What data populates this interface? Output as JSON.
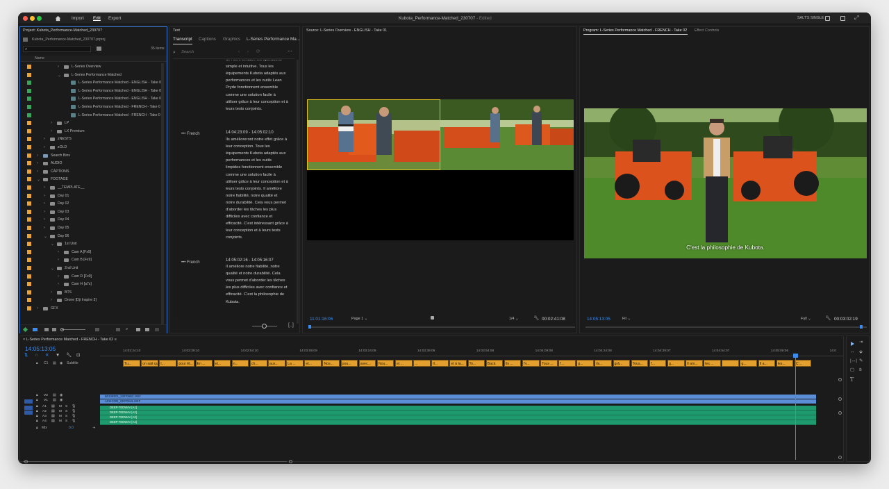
{
  "window": {
    "title": "Kubota_Performance-Matched_230707",
    "edited": "- Edited",
    "menu": [
      "Import",
      "Edit",
      "Export"
    ],
    "workspace": "SALT'S SINGLE"
  },
  "project": {
    "title": "Project: Kubota_Performance-Matched_230707",
    "file": "Kubota_Performance-Matched_230707.prproj",
    "items_count": "35 items",
    "name_header": "Name",
    "rows": [
      {
        "label": "L-Series Overview",
        "indent": 2,
        "type": "folder",
        "color": "#e8a33a",
        "chev": "›"
      },
      {
        "label": "L-Series Performance Matched",
        "indent": 2,
        "type": "folder",
        "color": "#e8a33a",
        "chev": "⌄"
      },
      {
        "label": "L-Series Performance Matched - ENGLISH - Take 0",
        "indent": 3,
        "type": "clip",
        "color": "#3aa55a",
        "chev": ""
      },
      {
        "label": "L-Series Performance Matched - ENGLISH - Take 0",
        "indent": 3,
        "type": "clip",
        "color": "#3aa55a",
        "chev": ""
      },
      {
        "label": "L-Series Performance Matched - ENGLISH - Take 0",
        "indent": 3,
        "type": "clip",
        "color": "#3aa55a",
        "chev": ""
      },
      {
        "label": "L-Series Performance Matched - FRENCH - Take 0",
        "indent": 3,
        "type": "clip",
        "color": "#3aa55a",
        "chev": ""
      },
      {
        "label": "L-Series Performance Matched - FRENCH - Take 0",
        "indent": 3,
        "type": "clip",
        "color": "#3aa55a",
        "chev": ""
      },
      {
        "label": "LP",
        "indent": 1,
        "type": "folder",
        "color": "#e8a33a",
        "chev": "›"
      },
      {
        "label": "LX Premium",
        "indent": 1,
        "type": "folder",
        "color": "#e8a33a",
        "chev": "›"
      },
      {
        "label": "zNESTS",
        "indent": 0,
        "type": "folder",
        "color": "#e8a33a",
        "chev": "›"
      },
      {
        "label": "zOLD",
        "indent": 0,
        "type": "folder",
        "color": "#e8a33a",
        "chev": "›"
      },
      {
        "label": "Search Bins",
        "indent": -1,
        "type": "search",
        "color": "#e8a33a",
        "chev": "›"
      },
      {
        "label": "AUDIO",
        "indent": -1,
        "type": "folder",
        "color": "#e8a33a",
        "chev": "›"
      },
      {
        "label": "CAPTIONS",
        "indent": -1,
        "type": "folder",
        "color": "#e8a33a",
        "chev": "›"
      },
      {
        "label": "FOOTAGE",
        "indent": -1,
        "type": "folder",
        "color": "#e8a33a",
        "chev": "⌄"
      },
      {
        "label": "__TEMPLATE__",
        "indent": 0,
        "type": "folder",
        "color": "#e8a33a",
        "chev": "›"
      },
      {
        "label": "Day 01",
        "indent": 0,
        "type": "folder",
        "color": "#e8a33a",
        "chev": "›"
      },
      {
        "label": "Day 02",
        "indent": 0,
        "type": "folder",
        "color": "#e8a33a",
        "chev": "›"
      },
      {
        "label": "Day 03",
        "indent": 0,
        "type": "folder",
        "color": "#e8a33a",
        "chev": "›"
      },
      {
        "label": "Day 04",
        "indent": 0,
        "type": "folder",
        "color": "#e8a33a",
        "chev": "›"
      },
      {
        "label": "Day 05",
        "indent": 0,
        "type": "folder",
        "color": "#e8a33a",
        "chev": "›"
      },
      {
        "label": "Day 06",
        "indent": 0,
        "type": "folder",
        "color": "#e8a33a",
        "chev": "⌄"
      },
      {
        "label": "1st Unit",
        "indent": 1,
        "type": "folder",
        "color": "#e8a33a",
        "chev": "⌄"
      },
      {
        "label": "Cam A [Fx9]",
        "indent": 2,
        "type": "folder",
        "color": "#e8a33a",
        "chev": "›"
      },
      {
        "label": "Cam B [Fx9]",
        "indent": 2,
        "type": "folder",
        "color": "#e8a33a",
        "chev": "›"
      },
      {
        "label": "2nd Unit",
        "indent": 1,
        "type": "folder",
        "color": "#e8a33a",
        "chev": "⌄"
      },
      {
        "label": "Cam D [Fx9]",
        "indent": 2,
        "type": "folder",
        "color": "#e8a33a",
        "chev": "›"
      },
      {
        "label": "Cam H [a7s]",
        "indent": 2,
        "type": "folder",
        "color": "#e8a33a",
        "chev": "›"
      },
      {
        "label": "BTS",
        "indent": 1,
        "type": "folder",
        "color": "#e8a33a",
        "chev": "›"
      },
      {
        "label": "Drone [Dji Inspire 3]",
        "indent": 1,
        "type": "folder",
        "color": "#e8a33a",
        "chev": "›"
      },
      {
        "label": "GFX",
        "indent": -1,
        "type": "folder",
        "color": "#e8a33a",
        "chev": "›"
      }
    ]
  },
  "text_panel": {
    "title": "Text",
    "tabs": [
      "Transcript",
      "Captions",
      "Graphics",
      "L-Series Performance Ma..."
    ],
    "search_placeholder": "Search",
    "block0_lines": [
      "de l'offre tentaire les opérations",
      "simple et intuitive. Tous les",
      "équipements Kubota adaptés aux",
      "performances et les outils Lean",
      "Pryde fonctionnent ensemble",
      "comme une solution facile à",
      "utiliser grâce à leur conception et à",
      "leurs tests conjoints."
    ],
    "block1": {
      "speaker": "French",
      "time": "14:04:23:09 - 14:05:02:10",
      "lines": [
        "Ils amélioreront notre effet grâce à",
        "leur conception. Tous les",
        "équipements Kubota adaptés aux",
        "performances et les outils",
        "limpides fonctionnent ensemble",
        "comme une solution facile à",
        "utiliser grâce à leur conception et à",
        "leurs tests conjoints. Il améliore",
        "notre fiabilité, notre qualité et",
        "notre durabilité. Cela vous permet",
        "d'aborder les tâches les plus",
        "difficiles avec confiance et",
        "efficacité. C'est intéressant grâce à",
        "leur conception et à leurs tests",
        "conjoints."
      ]
    },
    "block2": {
      "speaker": "French",
      "time": "14:05:02:16 - 14:05:16:07",
      "lines": [
        "Il améliore notre fiabilité, notre",
        "qualité et notre durabilité. Cela",
        "vous permet d'aborder les tâches",
        "les plus difficiles avec confiance et",
        "efficacité. C'est la philosophie de",
        "Kubota."
      ]
    }
  },
  "source_monitor": {
    "title": "Source: L-Series Overview - ENGLISH - Take 01",
    "timecode": "11:01:16:06",
    "page": "Page 1",
    "fraction": "1/4",
    "duration": "00:02:41:08"
  },
  "program_monitor": {
    "title": "Program: L-Series Performance Matched - FRENCH - Take 02",
    "effect_controls": "Effect Controls",
    "caption": "C'est la philosophie de Kubota.",
    "timecode": "14:05:13:05",
    "fit": "Fit",
    "quality": "Full",
    "duration": "00:03:02:19"
  },
  "timeline": {
    "title": "L-Series Performance Matched - FRENCH - Take 02",
    "timecode": "14:05:13:05",
    "ruler": [
      "14:02:24:10",
      "14:02:39:10",
      "14:02:54:10",
      "14:03:09:09",
      "14:03:24:09",
      "14:03:39:09",
      "14:03:54:08",
      "14:04:09:08",
      "14:04:24:08",
      "14:04:39:07",
      "14:04:54:07",
      "14:05:09:06",
      "14:0"
    ],
    "subtitle_track": "Subtitle",
    "subtitle_label": "C1",
    "captions": [
      "Tu...",
      "on sait que, en géné...",
      "I...",
      "pour êt...",
      "En ...",
      "et...",
      "n...",
      "ch...",
      "aux...",
      "La ...",
      "et...",
      "Nos...",
      "pou...",
      "avec...",
      "Nou...",
      "et ...",
      "...",
      "Il...",
      "et à la...",
      "To...",
      "Back.",
      "Ils ...",
      "l'v...",
      "Tous ...",
      "l'...",
      "g...",
      "ils...",
      "grâ...",
      "Tous...",
      "l'...",
      "g...",
      "Il am...",
      "les ...",
      "",
      "g...",
      "Il a...",
      "les...",
      "C'..."
    ],
    "video_tracks": [
      "V2",
      "V1"
    ],
    "audio_tracks": [
      "A1",
      "A2",
      "A3",
      "A4"
    ],
    "mix_label": "Mix",
    "mix_value": "0.0",
    "video_clips": [
      "B010R001_230706BC.MXF",
      "A011C002_230706UL.MXF"
    ],
    "audio_clips": [
      "DEEP-TEDWAV [A1]",
      "DEEP-TEDWAV [A2]",
      "DEEP-TEDWAV [A3]",
      "DEEP-TEDWAV [A4]"
    ]
  },
  "colors": {
    "accent": "#3a8cf0",
    "folder": "#e8a33a",
    "clip": "#3aa55a",
    "subtitle": "#e3a02f",
    "audio": "#1f9a6e",
    "video": "#5b8ed6"
  }
}
